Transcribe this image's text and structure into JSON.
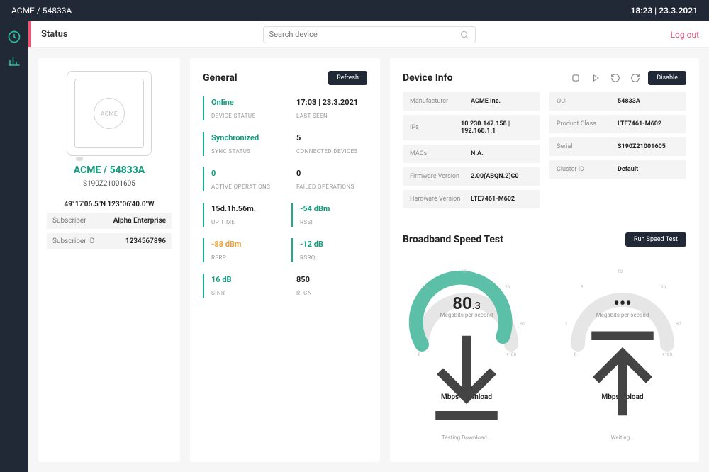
{
  "topbar": {
    "breadcrumb": "ACME / 54833A",
    "clock": "18:23",
    "date": "23.3.2021"
  },
  "subhead": {
    "title": "Status",
    "search_placeholder": "Search device",
    "logout": "Log out"
  },
  "device_card": {
    "logo_text": "ACME",
    "name": "ACME / 54833A",
    "serial": "S190Z21001605",
    "coords": "49°17'06.5\"N 123°06'40.0\"W",
    "subscriber_label": "Subscriber",
    "subscriber": "Alpha Enterprise",
    "subscriber_id_label": "Subscriber ID",
    "subscriber_id": "1234567896"
  },
  "general": {
    "title": "General",
    "refresh": "Refresh",
    "tiles": [
      [
        {
          "val": "Online",
          "lab": "DEVICE STATUS",
          "cls": "green"
        },
        {
          "val": "17:03 | 23.3.2021",
          "lab": "LAST SEEN",
          "cls": "plain"
        }
      ],
      [
        {
          "val": "Synchronized",
          "lab": "SYNC STATUS",
          "cls": "green"
        },
        {
          "val": "5",
          "lab": "CONNECTED DEVICES",
          "cls": "plain"
        }
      ],
      [
        {
          "val": "0",
          "lab": "ACTIVE OPERATIONS",
          "cls": "green"
        },
        {
          "val": "0",
          "lab": "FAILED OPERATIONS",
          "cls": "plain"
        }
      ],
      [
        {
          "val": "15d.1h.56m.",
          "lab": "UP TIME",
          "cls": "plain",
          "leftdark": true
        },
        {
          "val": "-54 dBm",
          "lab": "RSSI",
          "cls": "green"
        }
      ],
      [
        {
          "val": "-88 dBm",
          "lab": "RSRP",
          "cls": "orange"
        },
        {
          "val": "-12 dB",
          "lab": "RSRQ",
          "cls": "green"
        }
      ],
      [
        {
          "val": "16 dB",
          "lab": "SINR",
          "cls": "green"
        },
        {
          "val": "850",
          "lab": "RFCN",
          "cls": "plain"
        }
      ]
    ]
  },
  "device_info": {
    "title": "Device Info",
    "disable": "Disable",
    "left": [
      [
        "Manufacturer",
        "ACME Inc."
      ],
      [
        "IPs",
        "10.230.147.158 | 192.168.1.1"
      ],
      [
        "MACs",
        "N.A."
      ],
      [
        "Firmware Version",
        "2.00(ABQN.2)C0"
      ],
      [
        "Hardware Version",
        "LTE7461-M602"
      ]
    ],
    "right": [
      [
        "OUI",
        "54833A"
      ],
      [
        "Product Class",
        "LTE7461-M602"
      ],
      [
        "Serial",
        "S190Z21001605"
      ],
      [
        "Cluster ID",
        "Default"
      ]
    ]
  },
  "speed": {
    "title": "Broadband Speed Test",
    "run": "Run Speed Test",
    "download": {
      "value_int": "80",
      "value_dec": ".3",
      "unit": "Megabits per second",
      "status": "Testing Download...",
      "caption": "Mbps Download",
      "dots": "..."
    },
    "upload": {
      "value_int": "•••",
      "value_dec": "",
      "unit": "Megabits per second",
      "status": "Waiting...",
      "caption": "Mbps Upload",
      "dots": "..."
    },
    "ticks": {
      "t0": "0",
      "t1": "1",
      "t5": "5",
      "t10": "10",
      "t20": "20",
      "t50": "50",
      "t100": "+100"
    }
  }
}
